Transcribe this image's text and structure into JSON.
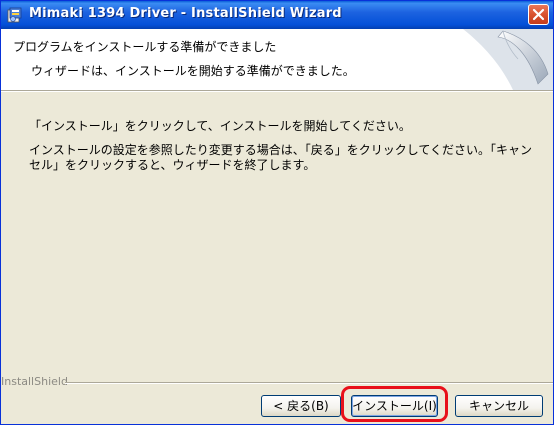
{
  "window": {
    "title": "Mimaki 1394 Driver - InstallShield Wizard",
    "title_icon": "installer-icon",
    "close_icon": "close-icon"
  },
  "header": {
    "title": "プログラムをインストールする準備ができました",
    "subtitle": "ウィザードは、インストールを開始する準備ができました。"
  },
  "body": {
    "paragraph1": "「インストール」をクリックして、インストールを開始してください。",
    "paragraph2": "インストールの設定を参照したり変更する場合は、「戻る」をクリックしてください。「キャンセル」をクリックすると、ウィザードを終了します。"
  },
  "footer": {
    "brand": "InstallShield",
    "back_label": "< 戻る(B)",
    "install_label": "インストール(I)",
    "cancel_label": "キャンセル"
  },
  "colors": {
    "titlebar": "#0450d8",
    "highlight": "#e8101a",
    "dialog_bg": "#ece9d8"
  }
}
